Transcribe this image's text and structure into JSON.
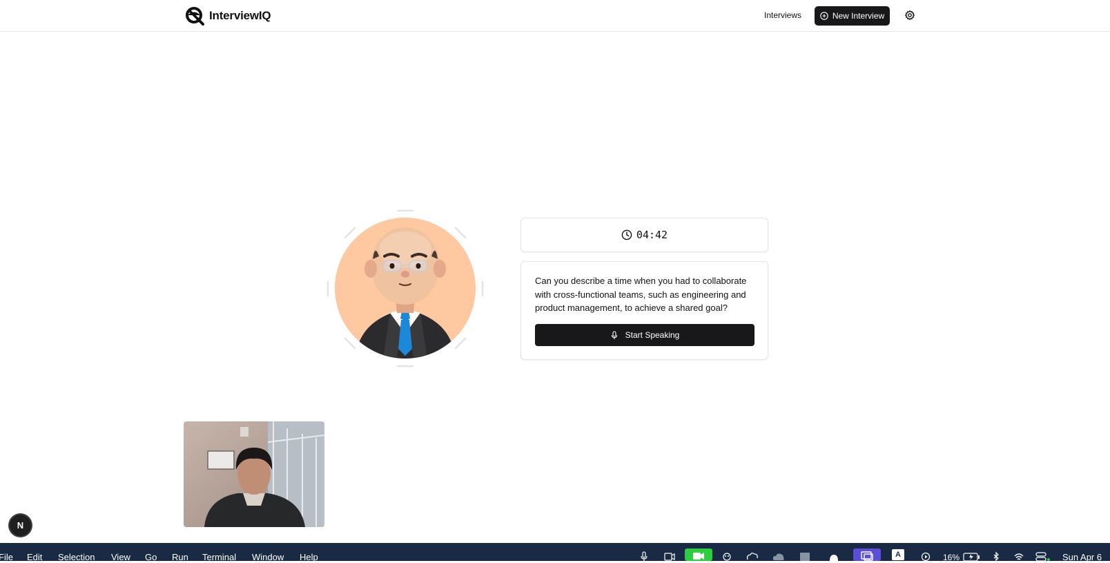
{
  "app": {
    "name": "InterviewIQ"
  },
  "nav": {
    "interviews_label": "Interviews",
    "new_interview_label": "New Interview"
  },
  "session": {
    "timer": "04:42",
    "question": "Can you describe a time when you had to collaborate with cross-functional teams, such as engineering and product management, to achieve a shared goal?",
    "speak_label": "Start Speaking"
  },
  "dev_badge": {
    "label": "N"
  },
  "os_menubar": {
    "items": [
      "File",
      "Edit",
      "Selection",
      "View",
      "Go",
      "Run",
      "Terminal",
      "Window",
      "Help"
    ],
    "battery": "16%",
    "clock": "Sun Apr 6"
  },
  "colors": {
    "primary": "#18181b",
    "avatar_bg": "#fec8a0",
    "menubar_bg": "#1a2a44",
    "facetime_green": "#2ecc40",
    "active_tray": "#5b4fd6"
  }
}
